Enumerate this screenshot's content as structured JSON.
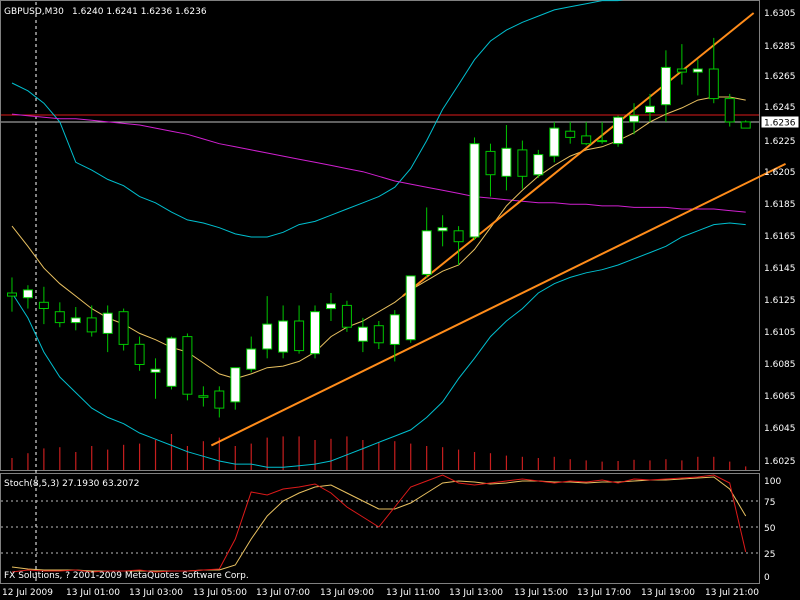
{
  "header": {
    "symbol": "GBPUSD,M30",
    "ohlc": "1.6240 1.6241 1.6236 1.6236"
  },
  "price_axis": {
    "labels": [
      "1.6305",
      "1.6285",
      "1.6265",
      "1.6245",
      "1.6225",
      "1.6205",
      "1.6185",
      "1.6165",
      "1.6145",
      "1.6125",
      "1.6105",
      "1.6085",
      "1.6065",
      "1.6045",
      "1.6025"
    ],
    "current_price": "1.6236"
  },
  "time_axis": {
    "labels": [
      "12 Jul 2009",
      "13 Jul 01:00",
      "13 Jul 03:00",
      "13 Jul 05:00",
      "13 Jul 07:00",
      "13 Jul 09:00",
      "13 Jul 11:00",
      "13 Jul 13:00",
      "13 Jul 15:00",
      "13 Jul 17:00",
      "13 Jul 19:00",
      "13 Jul 21:00"
    ]
  },
  "indicator": {
    "label": "Stoch(8,5,3) 27.1930 63.2072",
    "levels": [
      "100",
      "75",
      "50",
      "25",
      "0"
    ]
  },
  "copyright": "FX Solutions, ? 2001-2009 MetaQuotes Software Corp.",
  "colors": {
    "background": "#000000",
    "bull_candle": "#FFFFFF",
    "bear_candle": "#000000",
    "wick": "#00C800",
    "axis_text": "#FFFFFF",
    "bollinger": "#00BFCF",
    "ma_slow": "#D020D0",
    "ma_fast": "#E8C060",
    "channel": "#FF8C1A",
    "volume": "#C81E1E",
    "stoch_main": "#DD1A1A",
    "stoch_signal": "#E8C060",
    "price_line": "#DD1A1A"
  },
  "chart_data": {
    "type": "candlestick",
    "symbol": "GBPUSD",
    "timeframe": "M30",
    "ylim": [
      1.6022,
      1.631
    ],
    "candles": [
      {
        "o": 1.613,
        "h": 1.614,
        "l": 1.6118,
        "c": 1.6128
      },
      {
        "o": 1.6127,
        "h": 1.6135,
        "l": 1.612,
        "c": 1.6132
      },
      {
        "o": 1.6124,
        "h": 1.6134,
        "l": 1.611,
        "c": 1.612
      },
      {
        "o": 1.6118,
        "h": 1.6124,
        "l": 1.6108,
        "c": 1.6111
      },
      {
        "o": 1.6111,
        "h": 1.6121,
        "l": 1.6106,
        "c": 1.6114
      },
      {
        "o": 1.6114,
        "h": 1.6122,
        "l": 1.6102,
        "c": 1.6105
      },
      {
        "o": 1.6104,
        "h": 1.6122,
        "l": 1.6092,
        "c": 1.6117
      },
      {
        "o": 1.6118,
        "h": 1.612,
        "l": 1.6093,
        "c": 1.6097
      },
      {
        "o": 1.6097,
        "h": 1.6102,
        "l": 1.608,
        "c": 1.6084
      },
      {
        "o": 1.6079,
        "h": 1.6088,
        "l": 1.6062,
        "c": 1.6081
      },
      {
        "o": 1.607,
        "h": 1.6102,
        "l": 1.6068,
        "c": 1.6101
      },
      {
        "o": 1.6102,
        "h": 1.6104,
        "l": 1.6061,
        "c": 1.6065
      },
      {
        "o": 1.6064,
        "h": 1.607,
        "l": 1.6057,
        "c": 1.6063
      },
      {
        "o": 1.6067,
        "h": 1.607,
        "l": 1.605,
        "c": 1.6056
      },
      {
        "o": 1.606,
        "h": 1.6082,
        "l": 1.6055,
        "c": 1.6082
      },
      {
        "o": 1.6081,
        "h": 1.6102,
        "l": 1.6079,
        "c": 1.6094
      },
      {
        "o": 1.6094,
        "h": 1.6128,
        "l": 1.6088,
        "c": 1.611
      },
      {
        "o": 1.6092,
        "h": 1.6122,
        "l": 1.6088,
        "c": 1.6112
      },
      {
        "o": 1.6112,
        "h": 1.6122,
        "l": 1.6091,
        "c": 1.6093
      },
      {
        "o": 1.6091,
        "h": 1.6122,
        "l": 1.6088,
        "c": 1.6118
      },
      {
        "o": 1.612,
        "h": 1.613,
        "l": 1.6112,
        "c": 1.6123
      },
      {
        "o": 1.6122,
        "h": 1.6125,
        "l": 1.6105,
        "c": 1.6108
      },
      {
        "o": 1.6099,
        "h": 1.6114,
        "l": 1.6092,
        "c": 1.6108
      },
      {
        "o": 1.6109,
        "h": 1.6112,
        "l": 1.6094,
        "c": 1.6098
      },
      {
        "o": 1.6097,
        "h": 1.6119,
        "l": 1.6086,
        "c": 1.6116
      },
      {
        "o": 1.61,
        "h": 1.6141,
        "l": 1.6098,
        "c": 1.6141
      },
      {
        "o": 1.6142,
        "h": 1.6185,
        "l": 1.614,
        "c": 1.617
      },
      {
        "o": 1.617,
        "h": 1.618,
        "l": 1.616,
        "c": 1.6172
      },
      {
        "o": 1.617,
        "h": 1.6173,
        "l": 1.6148,
        "c": 1.6163
      },
      {
        "o": 1.6166,
        "h": 1.623,
        "l": 1.6164,
        "c": 1.6226
      },
      {
        "o": 1.6221,
        "h": 1.6226,
        "l": 1.6192,
        "c": 1.6206
      },
      {
        "o": 1.6205,
        "h": 1.6238,
        "l": 1.6196,
        "c": 1.6223
      },
      {
        "o": 1.6222,
        "h": 1.6228,
        "l": 1.6197,
        "c": 1.6205
      },
      {
        "o": 1.6206,
        "h": 1.6222,
        "l": 1.6204,
        "c": 1.6219
      },
      {
        "o": 1.6218,
        "h": 1.624,
        "l": 1.6214,
        "c": 1.6236
      },
      {
        "o": 1.6234,
        "h": 1.624,
        "l": 1.6226,
        "c": 1.623
      },
      {
        "o": 1.6231,
        "h": 1.624,
        "l": 1.6225,
        "c": 1.6226
      },
      {
        "o": 1.6228,
        "h": 1.624,
        "l": 1.6226,
        "c": 1.6228
      },
      {
        "o": 1.6226,
        "h": 1.6244,
        "l": 1.6224,
        "c": 1.6243
      },
      {
        "o": 1.624,
        "h": 1.6252,
        "l": 1.6232,
        "c": 1.6244
      },
      {
        "o": 1.6246,
        "h": 1.6258,
        "l": 1.624,
        "c": 1.625
      },
      {
        "o": 1.6251,
        "h": 1.6286,
        "l": 1.624,
        "c": 1.6275
      },
      {
        "o": 1.6274,
        "h": 1.629,
        "l": 1.6264,
        "c": 1.6272
      },
      {
        "o": 1.6272,
        "h": 1.628,
        "l": 1.6257,
        "c": 1.6274
      },
      {
        "o": 1.6274,
        "h": 1.6294,
        "l": 1.6252,
        "c": 1.6255
      },
      {
        "o": 1.6255,
        "h": 1.6258,
        "l": 1.6237,
        "c": 1.624
      },
      {
        "o": 1.624,
        "h": 1.6241,
        "l": 1.6236,
        "c": 1.6236
      }
    ],
    "volume_ylim": [
      0,
      100
    ],
    "volume": [
      20,
      28,
      36,
      38,
      30,
      40,
      34,
      42,
      44,
      50,
      60,
      40,
      48,
      54,
      40,
      44,
      54,
      56,
      56,
      50,
      52,
      56,
      50,
      46,
      48,
      44,
      40,
      38,
      34,
      30,
      28,
      24,
      22,
      20,
      22,
      18,
      16,
      14,
      15,
      17,
      16,
      18,
      16,
      22,
      22,
      14,
      6
    ],
    "stoch_ylim": [
      0,
      100
    ],
    "stoch_main": [
      7,
      9,
      8,
      8,
      9,
      7,
      8,
      8,
      9,
      7,
      8,
      8,
      9,
      10,
      40,
      87,
      84,
      90,
      92,
      95,
      86,
      72,
      62,
      52,
      72,
      92,
      98,
      104,
      96,
      94,
      96,
      98,
      100,
      98,
      96,
      98,
      97,
      99,
      96,
      100,
      99,
      100,
      101,
      102,
      104,
      96,
      27
    ],
    "stoch_signal": [
      12,
      10,
      9,
      9,
      9,
      8,
      8,
      8,
      8,
      8,
      8,
      8,
      9,
      9,
      14,
      40,
      63,
      78,
      86,
      92,
      94,
      86,
      78,
      70,
      70,
      76,
      86,
      96,
      98,
      97,
      95,
      96,
      98,
      98,
      97,
      97,
      96,
      97,
      97,
      98,
      99,
      99,
      100,
      101,
      102,
      90,
      63
    ],
    "bollinger_upper": [
      1.6265,
      1.626,
      1.6252,
      1.624,
      1.6214,
      1.6209,
      1.6203,
      1.6199,
      1.6192,
      1.6188,
      1.6182,
      1.6177,
      1.6175,
      1.6172,
      1.6168,
      1.6166,
      1.6166,
      1.6169,
      1.6174,
      1.6176,
      1.618,
      1.6184,
      1.6188,
      1.6192,
      1.6198,
      1.621,
      1.6228,
      1.6248,
      1.6264,
      1.628,
      1.6292,
      1.6299,
      1.6304,
      1.6308,
      1.6312,
      1.6314,
      1.6316,
      1.6318,
      1.6318,
      1.632,
      1.6322,
      1.6326,
      1.633,
      1.6332,
      1.6334,
      1.6336,
      1.6338
    ],
    "bollinger_lower": [
      1.613,
      1.6114,
      1.6092,
      1.6076,
      1.6066,
      1.6056,
      1.605,
      1.6046,
      1.604,
      1.6036,
      1.6032,
      1.6028,
      1.6025,
      1.6022,
      1.602,
      1.602,
      1.6018,
      1.6018,
      1.6019,
      1.602,
      1.6022,
      1.6026,
      1.603,
      1.6034,
      1.6038,
      1.6042,
      1.605,
      1.606,
      1.6075,
      1.6088,
      1.6102,
      1.6112,
      1.612,
      1.613,
      1.6136,
      1.614,
      1.6143,
      1.6145,
      1.6148,
      1.6152,
      1.6156,
      1.616,
      1.6166,
      1.617,
      1.6174,
      1.6175,
      1.6174
    ],
    "ma_fast": [
      1.6173,
      1.616,
      1.6146,
      1.6136,
      1.6128,
      1.612,
      1.6114,
      1.611,
      1.6104,
      1.61,
      1.6095,
      1.6092,
      1.6085,
      1.6078,
      1.6075,
      1.6078,
      1.6082,
      1.6083,
      1.6086,
      1.6092,
      1.6102,
      1.6108,
      1.6112,
      1.6118,
      1.6124,
      1.6132,
      1.6138,
      1.6144,
      1.6148,
      1.6158,
      1.6172,
      1.6186,
      1.6196,
      1.6205,
      1.6212,
      1.6218,
      1.6222,
      1.6224,
      1.6228,
      1.6233,
      1.624,
      1.6245,
      1.6249,
      1.6254,
      1.6256,
      1.6256,
      1.6254
    ],
    "ma_slow": [
      1.6245,
      1.6244,
      1.6243,
      1.6242,
      1.6242,
      1.6241,
      1.624,
      1.6239,
      1.6238,
      1.6236,
      1.6234,
      1.6232,
      1.6229,
      1.6226,
      1.6224,
      1.6222,
      1.622,
      1.6218,
      1.6216,
      1.6214,
      1.6212,
      1.621,
      1.6208,
      1.6205,
      1.6202,
      1.62,
      1.6198,
      1.6196,
      1.6194,
      1.6192,
      1.6191,
      1.619,
      1.6189,
      1.6188,
      1.6188,
      1.6187,
      1.6187,
      1.6186,
      1.6186,
      1.6185,
      1.6185,
      1.6185,
      1.6184,
      1.6184,
      1.6184,
      1.6183,
      1.6182
    ],
    "trendlines": [
      {
        "from": [
          25,
          1.6128
        ],
        "to": [
          47,
          1.631
        ]
      },
      {
        "from": [
          13,
          1.6032
        ],
        "to": [
          49,
          1.6213
        ]
      }
    ]
  }
}
